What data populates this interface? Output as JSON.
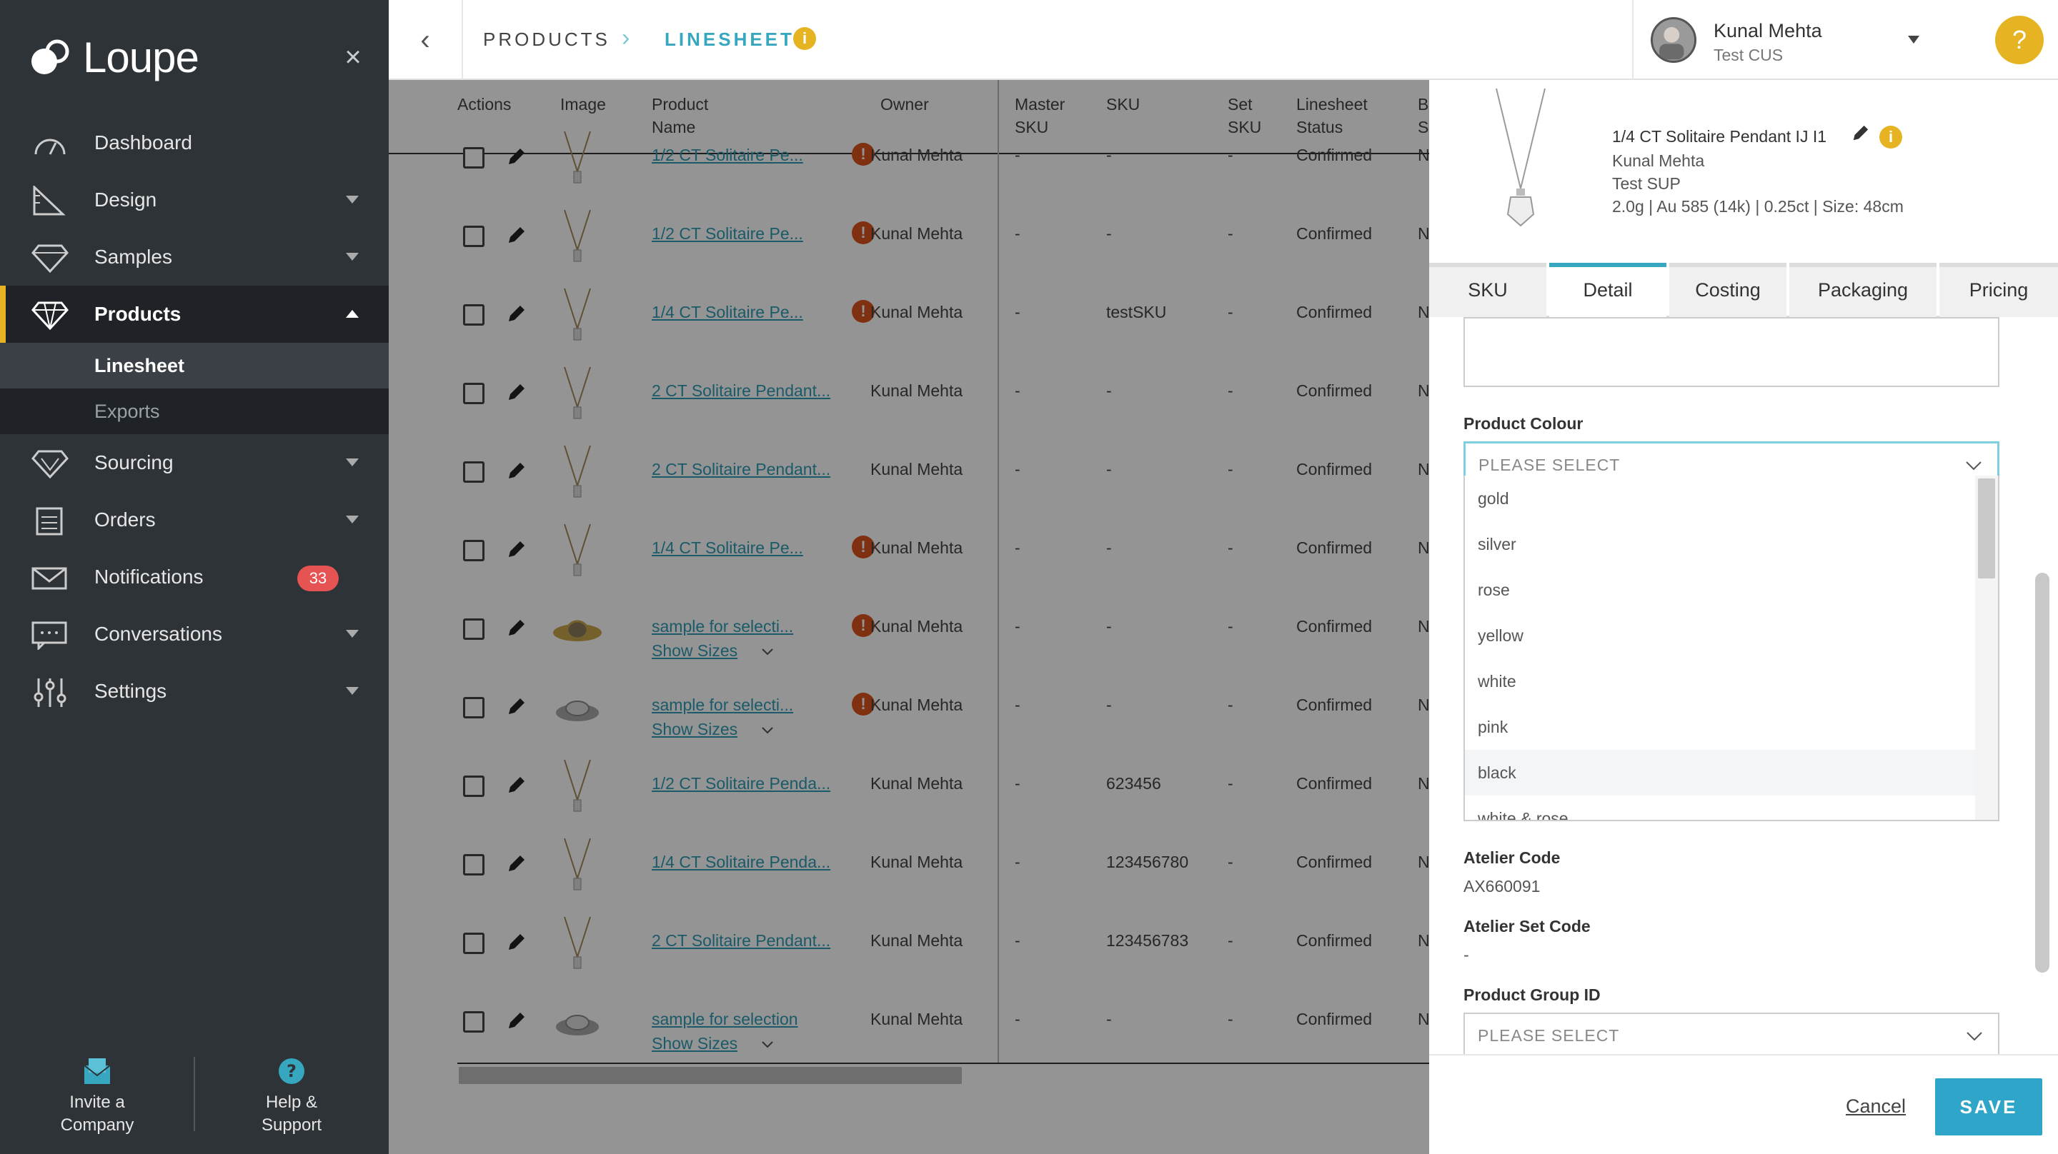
{
  "sidebar": {
    "logo_text": "Loupe",
    "items": [
      {
        "label": "Dashboard",
        "icon": "dashboard-icon"
      },
      {
        "label": "Design",
        "icon": "design-icon"
      },
      {
        "label": "Samples",
        "icon": "samples-icon"
      },
      {
        "label": "Products",
        "icon": "diamond-icon"
      },
      {
        "label": "Sourcing",
        "icon": "sourcing-icon"
      },
      {
        "label": "Orders",
        "icon": "clipboard-icon"
      },
      {
        "label": "Notifications",
        "icon": "envelope-icon",
        "badge": "33"
      },
      {
        "label": "Conversations",
        "icon": "chat-icon"
      },
      {
        "label": "Settings",
        "icon": "sliders-icon"
      }
    ],
    "sub_items": [
      "Linesheet",
      "Exports"
    ],
    "invite_label_1": "Invite a",
    "invite_label_2": "Company",
    "help_label_1": "Help &",
    "help_label_2": "Support"
  },
  "topbar": {
    "crumb1": "PRODUCTS",
    "crumb2": "LINESHEET",
    "user_name": "Kunal Mehta",
    "user_org": "Test CUS",
    "help_glyph": "?"
  },
  "table": {
    "columns": {
      "actions": "Actions",
      "image": "Image",
      "product_name_1": "Product",
      "product_name_2": "Name",
      "owner": "Owner",
      "master_1": "Master",
      "master_2": "SKU",
      "sku": "SKU",
      "set_1": "Set",
      "set_2": "SKU",
      "status_1": "Linesheet",
      "status_2": "Status",
      "b_1": "B",
      "b_2": "S"
    },
    "rows": [
      {
        "name": "1/2 CT Solitaire Pe...",
        "owner": "Kunal Mehta",
        "master": "-",
        "sku": "-",
        "set": "-",
        "status": "Confirmed",
        "b": "N",
        "warn": true,
        "sizes": false,
        "thumb": "pendant"
      },
      {
        "name": "1/2 CT Solitaire Pe...",
        "owner": "Kunal Mehta",
        "master": "-",
        "sku": "-",
        "set": "-",
        "status": "Confirmed",
        "b": "N",
        "warn": true,
        "sizes": false,
        "thumb": "pendant"
      },
      {
        "name": "1/4 CT Solitaire Pe...",
        "owner": "Kunal Mehta",
        "master": "-",
        "sku": "testSKU",
        "set": "-",
        "status": "Confirmed",
        "b": "N",
        "warn": true,
        "sizes": false,
        "thumb": "pendant"
      },
      {
        "name": "2 CT Solitaire Pendant...",
        "owner": "Kunal Mehta",
        "master": "-",
        "sku": "-",
        "set": "-",
        "status": "Confirmed",
        "b": "N",
        "warn": false,
        "sizes": false,
        "thumb": "pendant"
      },
      {
        "name": "2 CT Solitaire Pendant...",
        "owner": "Kunal Mehta",
        "master": "-",
        "sku": "-",
        "set": "-",
        "status": "Confirmed",
        "b": "N",
        "warn": false,
        "sizes": false,
        "thumb": "pendant"
      },
      {
        "name": "1/4 CT Solitaire Pe...",
        "owner": "Kunal Mehta",
        "master": "-",
        "sku": "-",
        "set": "-",
        "status": "Confirmed",
        "b": "N",
        "warn": true,
        "sizes": false,
        "thumb": "pendant"
      },
      {
        "name": "sample for selecti...",
        "owner": "Kunal Mehta",
        "master": "-",
        "sku": "-",
        "set": "-",
        "status": "Confirmed",
        "b": "N",
        "warn": true,
        "sizes": true,
        "thumb": "ring-gold"
      },
      {
        "name": "sample for selecti...",
        "owner": "Kunal Mehta",
        "master": "-",
        "sku": "-",
        "set": "-",
        "status": "Confirmed",
        "b": "N",
        "warn": true,
        "sizes": true,
        "thumb": "ring-silver"
      },
      {
        "name": "1/2 CT Solitaire Penda...",
        "owner": "Kunal Mehta",
        "master": "-",
        "sku": "623456",
        "set": "-",
        "status": "Confirmed",
        "b": "N",
        "warn": false,
        "sizes": false,
        "thumb": "pendant"
      },
      {
        "name": "1/4 CT Solitaire Penda...",
        "owner": "Kunal Mehta",
        "master": "-",
        "sku": "123456780",
        "set": "-",
        "status": "Confirmed",
        "b": "N",
        "warn": false,
        "sizes": false,
        "thumb": "pendant"
      },
      {
        "name": "2 CT Solitaire Pendant...",
        "owner": "Kunal Mehta",
        "master": "-",
        "sku": "123456783",
        "set": "-",
        "status": "Confirmed",
        "b": "N",
        "warn": false,
        "sizes": false,
        "thumb": "pendant"
      },
      {
        "name": "sample for selection",
        "owner": "Kunal Mehta",
        "master": "-",
        "sku": "-",
        "set": "-",
        "status": "Confirmed",
        "b": "N",
        "warn": false,
        "sizes": true,
        "thumb": "ring-silver"
      }
    ],
    "show_sizes_label": "Show Sizes",
    "warn_glyph": "!"
  },
  "panel": {
    "product_title": "1/4 CT Solitaire Pendant IJ I1",
    "product_owner": "Kunal Mehta",
    "product_supplier": "Test SUP",
    "product_specs": "2.0g | Au 585 (14k) | 0.25ct | Size: 48cm",
    "tabs": [
      "SKU",
      "Detail",
      "Costing",
      "Packaging",
      "Pricing"
    ],
    "active_tab": "Detail",
    "product_colour_label": "Product Colour",
    "product_colour_placeholder": "PLEASE SELECT",
    "colour_options": [
      "gold",
      "silver",
      "rose",
      "yellow",
      "white",
      "pink",
      "black",
      "white & rose"
    ],
    "hovered_option": "black",
    "atelier_code_label": "Atelier Code",
    "atelier_code_value": "AX660091",
    "atelier_set_code_label": "Atelier Set Code",
    "atelier_set_code_value": "-",
    "product_group_label": "Product Group ID",
    "product_group_placeholder": "PLEASE SELECT",
    "cancel_label": "Cancel",
    "save_label": "SAVE",
    "info_glyph": "i"
  },
  "colors": {
    "sidebar_bg": "#2e3338",
    "accent_teal": "#37a6bf",
    "accent_yellow": "#e6b422",
    "badge_red": "#e55353",
    "save_blue": "#2fa5c9"
  }
}
